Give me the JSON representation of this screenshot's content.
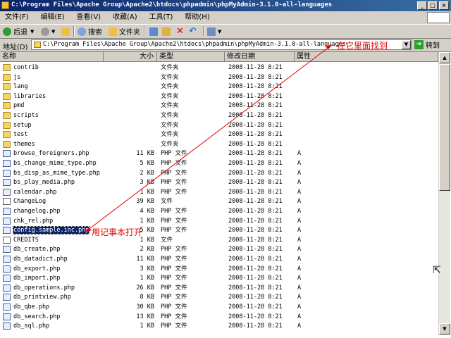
{
  "window": {
    "title": "C:\\Program Files\\Apache Group\\Apache2\\htdocs\\phpadmin\\phpMyAdmin-3.1.0-all-languages"
  },
  "menu": [
    "文件(F)",
    "编辑(E)",
    "查看(V)",
    "收藏(A)",
    "工具(T)",
    "帮助(H)"
  ],
  "toolbar": {
    "back": "后退",
    "search": "搜索",
    "folders": "文件夹"
  },
  "address": {
    "label": "地址(D)",
    "value": "C:\\Program Files\\Apache Group\\Apache2\\htdocs\\phpadmin\\phpMyAdmin-3.1.0-all-languages",
    "go": "转到"
  },
  "annotations": {
    "find_inside": "在它里面找到",
    "open_with_notepad": "用记事本打开"
  },
  "columns": {
    "name": "名称",
    "size": "大小",
    "type": "类型",
    "modified": "修改日期",
    "attributes": "属性"
  },
  "files": [
    {
      "name": "contrib",
      "size": "",
      "type": "文件夹",
      "date": "2008-11-28 8:21",
      "attr": "",
      "kind": "folder"
    },
    {
      "name": "js",
      "size": "",
      "type": "文件夹",
      "date": "2008-11-28 8:21",
      "attr": "",
      "kind": "folder"
    },
    {
      "name": "lang",
      "size": "",
      "type": "文件夹",
      "date": "2008-11-28 8:21",
      "attr": "",
      "kind": "folder"
    },
    {
      "name": "libraries",
      "size": "",
      "type": "文件夹",
      "date": "2008-11-28 8:21",
      "attr": "",
      "kind": "folder"
    },
    {
      "name": "pmd",
      "size": "",
      "type": "文件夹",
      "date": "2008-11-28 8:21",
      "attr": "",
      "kind": "folder"
    },
    {
      "name": "scripts",
      "size": "",
      "type": "文件夹",
      "date": "2008-11-28 8:21",
      "attr": "",
      "kind": "folder"
    },
    {
      "name": "setup",
      "size": "",
      "type": "文件夹",
      "date": "2008-11-28 8:21",
      "attr": "",
      "kind": "folder"
    },
    {
      "name": "test",
      "size": "",
      "type": "文件夹",
      "date": "2008-11-28 8:21",
      "attr": "",
      "kind": "folder"
    },
    {
      "name": "themes",
      "size": "",
      "type": "文件夹",
      "date": "2008-11-28 8:21",
      "attr": "",
      "kind": "folder"
    },
    {
      "name": "browse_foreigners.php",
      "size": "11 KB",
      "type": "PHP 文件",
      "date": "2008-11-28 8:21",
      "attr": "A",
      "kind": "php"
    },
    {
      "name": "bs_change_mime_type.php",
      "size": "5 KB",
      "type": "PHP 文件",
      "date": "2008-11-28 8:21",
      "attr": "A",
      "kind": "php"
    },
    {
      "name": "bs_disp_as_mime_type.php",
      "size": "2 KB",
      "type": "PHP 文件",
      "date": "2008-11-28 8:21",
      "attr": "A",
      "kind": "php"
    },
    {
      "name": "bs_play_media.php",
      "size": "3 KB",
      "type": "PHP 文件",
      "date": "2008-11-28 8:21",
      "attr": "A",
      "kind": "php"
    },
    {
      "name": "calendar.php",
      "size": "1 KB",
      "type": "PHP 文件",
      "date": "2008-11-28 8:21",
      "attr": "A",
      "kind": "php"
    },
    {
      "name": "ChangeLog",
      "size": "39 KB",
      "type": "文件",
      "date": "2008-11-28 8:21",
      "attr": "A",
      "kind": "txt"
    },
    {
      "name": "changelog.php",
      "size": "4 KB",
      "type": "PHP 文件",
      "date": "2008-11-28 8:21",
      "attr": "A",
      "kind": "php"
    },
    {
      "name": "chk_rel.php",
      "size": "1 KB",
      "type": "PHP 文件",
      "date": "2008-11-28 8:21",
      "attr": "A",
      "kind": "php"
    },
    {
      "name": "config.sample.inc.php",
      "size": "5 KB",
      "type": "PHP 文件",
      "date": "2008-11-28 8:21",
      "attr": "A",
      "kind": "php",
      "selected": true
    },
    {
      "name": "CREDITS",
      "size": "1 KB",
      "type": "文件",
      "date": "2008-11-28 8:21",
      "attr": "A",
      "kind": "txt"
    },
    {
      "name": "db_create.php",
      "size": "2 KB",
      "type": "PHP 文件",
      "date": "2008-11-28 8:21",
      "attr": "A",
      "kind": "php"
    },
    {
      "name": "db_datadict.php",
      "size": "11 KB",
      "type": "PHP 文件",
      "date": "2008-11-28 8:21",
      "attr": "A",
      "kind": "php"
    },
    {
      "name": "db_export.php",
      "size": "3 KB",
      "type": "PHP 文件",
      "date": "2008-11-28 8:21",
      "attr": "A",
      "kind": "php"
    },
    {
      "name": "db_import.php",
      "size": "1 KB",
      "type": "PHP 文件",
      "date": "2008-11-28 8:21",
      "attr": "A",
      "kind": "php"
    },
    {
      "name": "db_operations.php",
      "size": "26 KB",
      "type": "PHP 文件",
      "date": "2008-11-28 8:21",
      "attr": "A",
      "kind": "php"
    },
    {
      "name": "db_printview.php",
      "size": "8 KB",
      "type": "PHP 文件",
      "date": "2008-11-28 8:21",
      "attr": "A",
      "kind": "php"
    },
    {
      "name": "db_qbe.php",
      "size": "30 KB",
      "type": "PHP 文件",
      "date": "2008-11-28 8:21",
      "attr": "A",
      "kind": "php"
    },
    {
      "name": "db_search.php",
      "size": "13 KB",
      "type": "PHP 文件",
      "date": "2008-11-28 8:21",
      "attr": "A",
      "kind": "php"
    },
    {
      "name": "db_sql.php",
      "size": "1 KB",
      "type": "PHP 文件",
      "date": "2008-11-28 8:21",
      "attr": "A",
      "kind": "php"
    }
  ],
  "colors": {
    "annotation": "#e00000",
    "selection": "#0a246a",
    "titlebar": "#0a246a"
  }
}
